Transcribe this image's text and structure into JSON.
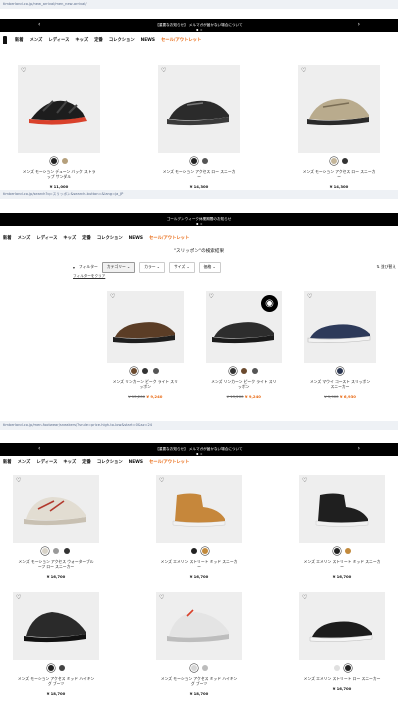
{
  "s1": {
    "url": "timberland.co.jp/new_arrival/men_new-arrival/",
    "banner": "【重要なお知らせ】 メルマガが届かない場合について",
    "nav": [
      "新着",
      "メンズ",
      "レディース",
      "キッズ",
      "定番",
      "コレクション",
      "NEWS",
      "セール/アウトレット"
    ],
    "products": [
      {
        "name": "メンズ モーション デューン バック ストラップ サンダル",
        "price": "¥ 11,000",
        "swatches": [
          "#222222",
          "#b5a07c"
        ]
      },
      {
        "name": "メンズ モーション アクセス ロー スニーカー",
        "price": "¥ 14,300",
        "swatches": [
          "#222222",
          "#555555"
        ]
      },
      {
        "name": "メンズ モーション アクセス ロー スニーカー",
        "price": "¥ 14,300",
        "swatches": [
          "#c4b69a",
          "#333333"
        ]
      }
    ]
  },
  "s2": {
    "url": "timberland.co.jp/search?q=スリッポン&search-button=&lang=ja_JP",
    "banner": "ゴールデンウィーク休業期間のお知らせ",
    "nav": [
      "新着",
      "メンズ",
      "レディース",
      "キッズ",
      "定番",
      "コレクション",
      "NEWS",
      "セール/アウトレット"
    ],
    "results_title": "\"スリッポン\"の検索結果",
    "filters": [
      "フィルター",
      "カテゴリー",
      "カラー",
      "サイズ",
      "価格"
    ],
    "sort": "並び替え",
    "reset": "フィルターをクリア",
    "products": [
      {
        "name": "メンズ リンカーン ピーク ライト スリッポン",
        "old_price": "¥ 13,200",
        "new_price": "¥ 9,240",
        "swatches": [
          "#6b4a2e",
          "#333333",
          "#555555"
        ]
      },
      {
        "name": "メンズ リンカーン ピーク ライト スリッポン",
        "old_price": "¥ 13,200",
        "new_price": "¥ 9,240",
        "swatches": [
          "#333333",
          "#6b4a2e",
          "#555555"
        ]
      },
      {
        "name": "メンズ マウイ コースト スリッポン スニーカー",
        "old_price": "¥ 9,900",
        "new_price": "¥ 6,930",
        "swatches": [
          "#2a3550"
        ]
      }
    ]
  },
  "s3": {
    "url": "timberland.co.jp/men-footwear/sneakers/?srule=price-high-to-low&start=0&sz=24",
    "banner": "【重要なお知らせ】 メルマガが届かない場合について",
    "nav": [
      "新着",
      "メンズ",
      "レディース",
      "キッズ",
      "定番",
      "コレクション",
      "NEWS",
      "セール/アウトレット"
    ],
    "products": [
      {
        "name": "メンズ モーション アクセス ウォーターブルーフ ロー スニーカー",
        "price": "¥ 16,700",
        "swatches": [
          "#d8d3c8",
          "#9a9a9a",
          "#333333"
        ]
      },
      {
        "name": "メンズ エメリン ストリート ミッド スニーカー",
        "price": "¥ 16,700",
        "swatches": [
          "#222222",
          "#c28a3c"
        ]
      },
      {
        "name": "メンズ エメリン ストリート ミッド スニーカー",
        "price": "¥ 16,700",
        "swatches": [
          "#222222",
          "#c28a3c"
        ]
      },
      {
        "name": "メンズ モーション アクセス ミッド ハイキング ブーツ",
        "price": "¥ 18,700",
        "swatches": [
          "#222222",
          "#444444"
        ]
      },
      {
        "name": "メンズ モーション アクセス ミッド ハイキング ブーツ",
        "price": "¥ 18,700",
        "swatches": [
          "#d6d6d6",
          "#bcbcbc"
        ]
      },
      {
        "name": "メンズ エメリン ストリート ロー スニーカー",
        "price": "¥ 16,700",
        "swatches": [
          "#e0e0e0",
          "#222222"
        ]
      }
    ]
  }
}
